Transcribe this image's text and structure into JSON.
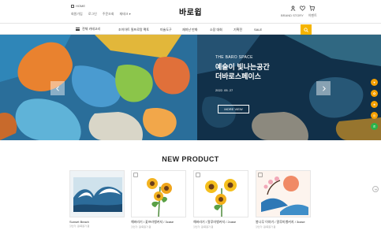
{
  "header": {
    "home_label": "HOME",
    "util_links": [
      "회원가입",
      "로그인",
      "주문조회",
      "재테크 ▾"
    ],
    "logo": "바로윕",
    "right_links": [
      "BRAND STORY",
      "이벤트"
    ]
  },
  "nav": {
    "all_category": "전체 카테고리",
    "items": [
      "조이아트 필프로랑 팩토",
      "미술도구",
      "재미난 만화",
      "소장 대회",
      "기획전",
      "SALE"
    ]
  },
  "hero": {
    "eyebrow": "THE BARO SPACE",
    "title_line1": "예술이 빛나는공간",
    "title_line2": "더바로스페이스",
    "date": "2022. 05. 27",
    "button": "MORE VIEW"
  },
  "products_section": {
    "title": "NEW PRODUCT",
    "items": [
      {
        "name": "Sunset Beach",
        "sub": "할인가: 원/회원가 원"
      },
      {
        "name": "해바라기 / 꽃프라뱅커지 / 3case",
        "sub": "할인가: 원/회원가 원"
      },
      {
        "name": "해바라기 / 알루미뱅커지 / 2case",
        "sub": "할인가: 원/회원가 원"
      },
      {
        "name": "봉나무 이야기 / 알루미뱅커지 / 3case",
        "sub": "할인가: 원/회원가 원"
      }
    ]
  },
  "floating": {
    "labels": [
      "♥",
      "✿",
      "★",
      "◎",
      "✆"
    ]
  },
  "colors": {
    "accent": "#f5b400",
    "float": "#f5a000",
    "green": "#2bb34a"
  }
}
